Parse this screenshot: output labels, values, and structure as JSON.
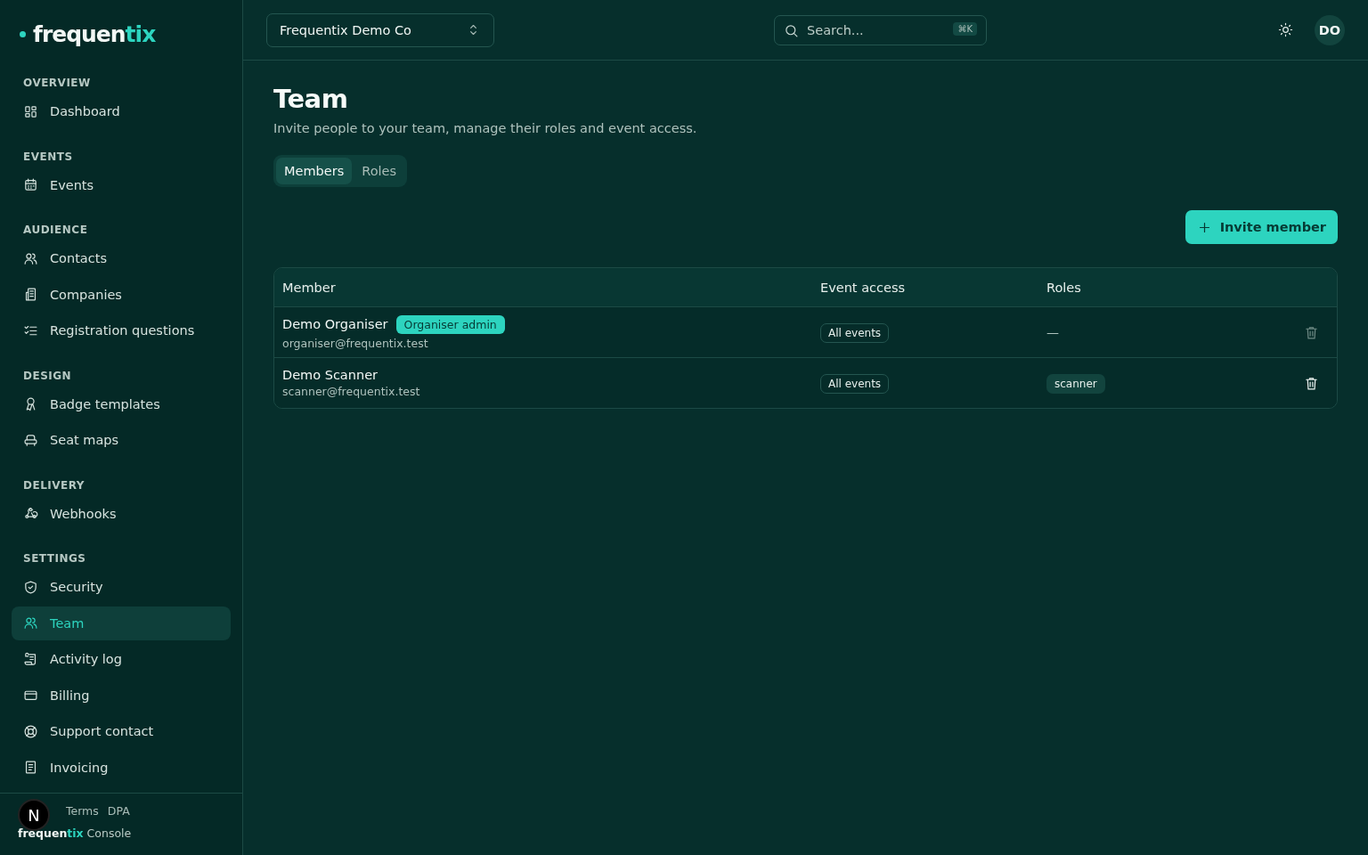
{
  "sidebar": {
    "logo": {
      "main": "frequen",
      "accent": "tix"
    },
    "sections": [
      {
        "heading": "OVERVIEW",
        "items": [
          {
            "label": "Dashboard",
            "selected": false
          }
        ]
      },
      {
        "heading": "EVENTS",
        "items": [
          {
            "label": "Events",
            "selected": false
          }
        ]
      },
      {
        "heading": "AUDIENCE",
        "items": [
          {
            "label": "Contacts",
            "selected": false
          },
          {
            "label": "Companies",
            "selected": false
          },
          {
            "label": "Registration questions",
            "selected": false
          }
        ]
      },
      {
        "heading": "DESIGN",
        "items": [
          {
            "label": "Badge templates",
            "selected": false
          },
          {
            "label": "Seat maps",
            "selected": false
          }
        ]
      },
      {
        "heading": "DELIVERY",
        "items": [
          {
            "label": "Webhooks",
            "selected": false
          }
        ]
      },
      {
        "heading": "SETTINGS",
        "items": [
          {
            "label": "Security",
            "selected": false
          },
          {
            "label": "Team",
            "selected": true
          },
          {
            "label": "Activity log",
            "selected": false
          },
          {
            "label": "Billing",
            "selected": false
          },
          {
            "label": "Support contact",
            "selected": false
          },
          {
            "label": "Invoicing",
            "selected": false
          }
        ]
      }
    ],
    "footer": {
      "links": [
        "Terms",
        "DPA"
      ],
      "brand_main": "frequen",
      "brand_accent": "tix",
      "brand_suffix": "Console",
      "dev_badge": "N"
    }
  },
  "topbar": {
    "org_switcher": "Frequentix Demo Co",
    "search": {
      "placeholder": "Search...",
      "shortcut": "⌘K"
    },
    "avatar": "DO"
  },
  "page": {
    "title": "Team",
    "subtitle": "Invite people to your team, manage their roles and event access.",
    "tabs": [
      {
        "label": "Members",
        "selected": true
      },
      {
        "label": "Roles",
        "selected": false
      }
    ],
    "invite_button": "Invite member"
  },
  "table": {
    "columns": [
      "Member",
      "Event access",
      "Roles"
    ],
    "rows": [
      {
        "name": "Demo Organiser",
        "badge": "Organiser admin",
        "email": "organiser@frequentix.test",
        "event_access": "All events",
        "roles": [],
        "roles_empty": "—",
        "removable": false
      },
      {
        "name": "Demo Scanner",
        "email": "scanner@frequentix.test",
        "event_access": "All events",
        "roles": [
          "scanner"
        ],
        "removable": true
      }
    ]
  }
}
